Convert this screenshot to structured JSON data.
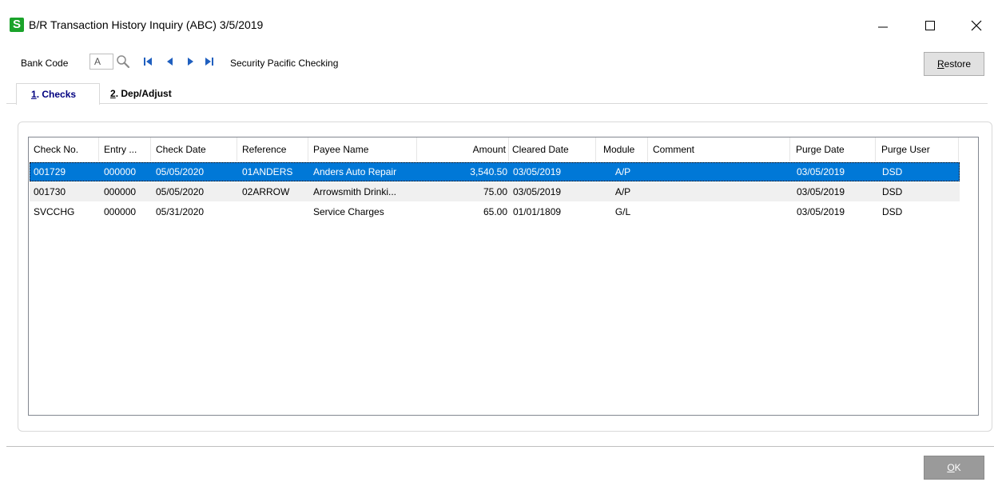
{
  "window": {
    "icon_letter": "S",
    "title": "B/R Transaction History Inquiry (ABC) 3/5/2019"
  },
  "toolbar": {
    "bank_code_label": "Bank Code",
    "bank_code_value": "A",
    "bank_description": "Security Pacific Checking",
    "restore_label": "Restore"
  },
  "tabs": [
    {
      "num": "1",
      "label": ". Checks"
    },
    {
      "num": "2",
      "label": ". Dep/Adjust"
    }
  ],
  "grid": {
    "columns": [
      "Check No.",
      "Entry ...",
      "Check Date",
      "Reference",
      "Payee Name",
      "Amount",
      "Cleared Date",
      "Module",
      "Comment",
      "Purge Date",
      "Purge User"
    ],
    "rows": [
      [
        "001729",
        "000000",
        "05/05/2020",
        "01ANDERS",
        "Anders Auto Repair",
        "3,540.50",
        "03/05/2019",
        "A/P",
        "",
        "03/05/2019",
        "DSD"
      ],
      [
        "001730",
        "000000",
        "05/05/2020",
        "02ARROW",
        "Arrowsmith Drinki...",
        "75.00",
        "03/05/2019",
        "A/P",
        "",
        "03/05/2019",
        "DSD"
      ],
      [
        "SVCCHG",
        "000000",
        "05/31/2020",
        "",
        "Service Charges",
        "65.00",
        "01/01/1809",
        "G/L",
        "",
        "03/05/2019",
        "DSD"
      ]
    ]
  },
  "footer": {
    "ok_label": "OK"
  },
  "colors": {
    "selection": "#0078d7",
    "app_icon": "#1aa32a",
    "nav_icon": "#1f5fbf"
  }
}
